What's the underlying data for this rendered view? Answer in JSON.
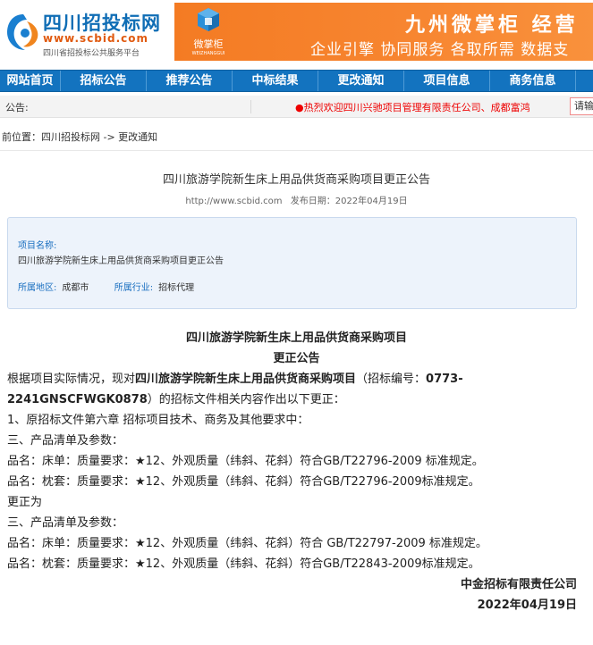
{
  "header": {
    "logo_title": "四川招投标网",
    "logo_url": "www.scbid.com",
    "logo_subtitle": "四川省招投标公共服务平台",
    "banner": {
      "brand_name": "微掌柜",
      "brand_en": "WEIZHANGGUI",
      "title": "九州微掌柜 经营",
      "slogan": "企业引擎 协同服务 各取所需   数据支",
      "accent_color": "#f47b23"
    }
  },
  "nav": {
    "items": [
      {
        "label": "网站首页"
      },
      {
        "label": "招标公告"
      },
      {
        "label": "推荐公告"
      },
      {
        "label": "中标结果"
      },
      {
        "label": "更改通知"
      },
      {
        "label": "项目信息"
      },
      {
        "label": "商务信息"
      }
    ]
  },
  "notice": {
    "label": "公告:",
    "marquee": "●热烈欢迎四川兴驰项目管理有限责任公司、成都富鸿",
    "button": "请输"
  },
  "breadcrumb": "前位置：四川招投标网 -> 更改通知",
  "article": {
    "title": "四川旅游学院新生床上用品供货商采购项目更正公告",
    "source": "http://www.scbid.com",
    "date": "发布日期：2022年04月19日"
  },
  "info": {
    "name_label": "项目名称:",
    "name_value": "四川旅游学院新生床上用品供货商采购项目更正公告",
    "region_label": "所属地区:",
    "region_value": "成都市",
    "industry_label": "所属行业:",
    "industry_value": "招标代理"
  },
  "content": {
    "heading1": "四川旅游学院新生床上用品供货商采购项目",
    "heading2": "更正公告",
    "intro_a": "根据项目实际情况，现对",
    "intro_b": "四川旅游学院新生床上用品供货商采购项目",
    "intro_c": "（招标编号：",
    "intro_d": "0773-",
    "intro_e": "2241GNSCFWGK0878",
    "intro_f": "）的招标文件相关内容作出以下更正：",
    "l1": "1、原招标文件第六章 招标项目技术、商务及其他要求中：",
    "l2": "三、产品清单及参数：",
    "l3": "品名：床单：质量要求：★12、外观质量（纬斜、花斜）符合GB/T22796-2009 标准规定。",
    "l4": "品名：枕套：质量要求：★12、外观质量（纬斜、花斜）符合GB/T22796-2009标准规定。",
    "l5": "更正为",
    "l6": "三、产品清单及参数：",
    "l7": "品名：床单：质量要求：★12、外观质量（纬斜、花斜）符合 GB/T22797-2009 标准规定。",
    "l8": "品名：枕套：质量要求：★12、外观质量（纬斜、花斜）符合GB/T22843-2009标准规定。",
    "signer": "中金招标有限责任公司",
    "sign_date": "2022年04月19日"
  }
}
